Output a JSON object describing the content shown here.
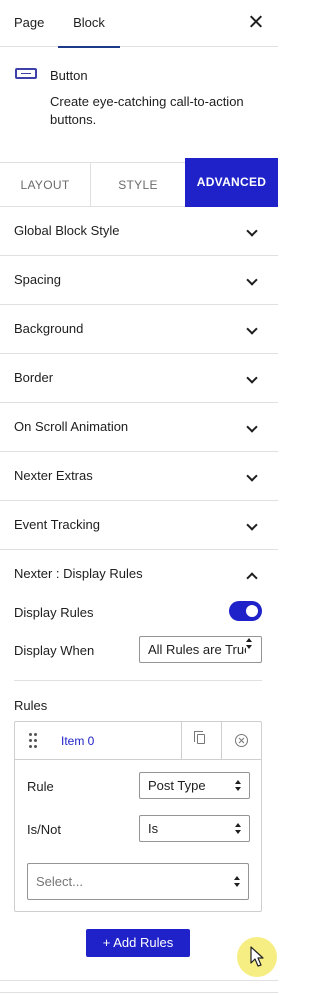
{
  "header": {
    "tabs": [
      {
        "label": "Page"
      },
      {
        "label": "Block"
      }
    ],
    "active_tab": "Block"
  },
  "block": {
    "icon": "button-icon",
    "title": "Button",
    "description": "Create eye-catching call-to-action buttons."
  },
  "panel_tabs": [
    {
      "label": "LAYOUT"
    },
    {
      "label": "STYLE"
    },
    {
      "label": "ADVANCED"
    }
  ],
  "active_panel_tab": "ADVANCED",
  "accordion": [
    {
      "label": "Global Block Style"
    },
    {
      "label": "Spacing"
    },
    {
      "label": "Background"
    },
    {
      "label": "Border"
    },
    {
      "label": "On Scroll Animation"
    },
    {
      "label": "Nexter Extras"
    },
    {
      "label": "Event Tracking"
    },
    {
      "label": "Nexter : Display Rules"
    }
  ],
  "display_rules": {
    "toggle_label": "Display Rules",
    "toggle_on": true,
    "display_when_label": "Display When",
    "display_when_value": "All Rules are True",
    "rules_label": "Rules",
    "item": {
      "title": "Item 0",
      "rule_label": "Rule",
      "rule_value": "Post Type",
      "isnot_label": "Is/Not",
      "isnot_value": "Is",
      "select_placeholder": "Select..."
    },
    "add_button": "+ Add Rules"
  },
  "colors": {
    "accent": "#1f22c9",
    "tab_underline": "#1b3a8a"
  }
}
